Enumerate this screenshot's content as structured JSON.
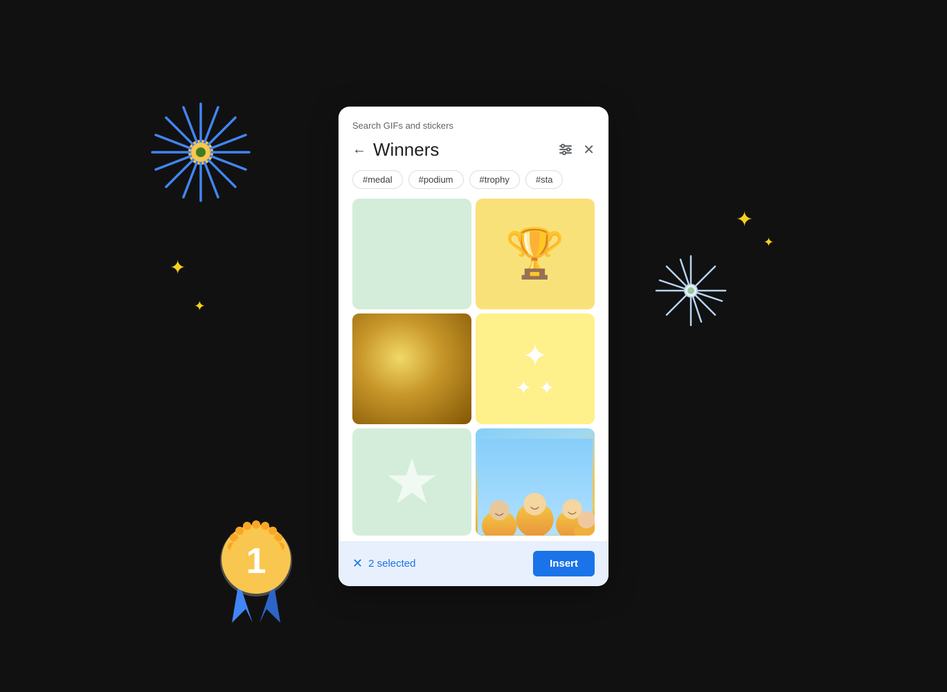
{
  "background": "#111",
  "search_label": "Search GIFs and stickers",
  "nav": {
    "back_label": "←",
    "title": "Winners",
    "filter_label": "⚙",
    "close_label": "✕"
  },
  "tags": [
    "#medal",
    "#podium",
    "#trophy",
    "#sta"
  ],
  "grid": [
    {
      "id": 1,
      "type": "plain-green",
      "label": "green background"
    },
    {
      "id": 2,
      "type": "trophy",
      "label": "trophy icon"
    },
    {
      "id": 3,
      "type": "gold-shimmer",
      "label": "golden sparkle"
    },
    {
      "id": 4,
      "type": "sparkles",
      "label": "sparkle stars"
    },
    {
      "id": 5,
      "type": "star",
      "label": "star icon on green"
    },
    {
      "id": 6,
      "type": "people",
      "label": "happy people"
    }
  ],
  "bottom_bar": {
    "selected_count": "2 selected",
    "clear_label": "✕",
    "insert_label": "Insert"
  },
  "colors": {
    "accent_blue": "#1a73e8",
    "tag_border": "#dadce0",
    "dialog_bg": "#ffffff",
    "bottom_bar_bg": "#e8f0fe"
  }
}
